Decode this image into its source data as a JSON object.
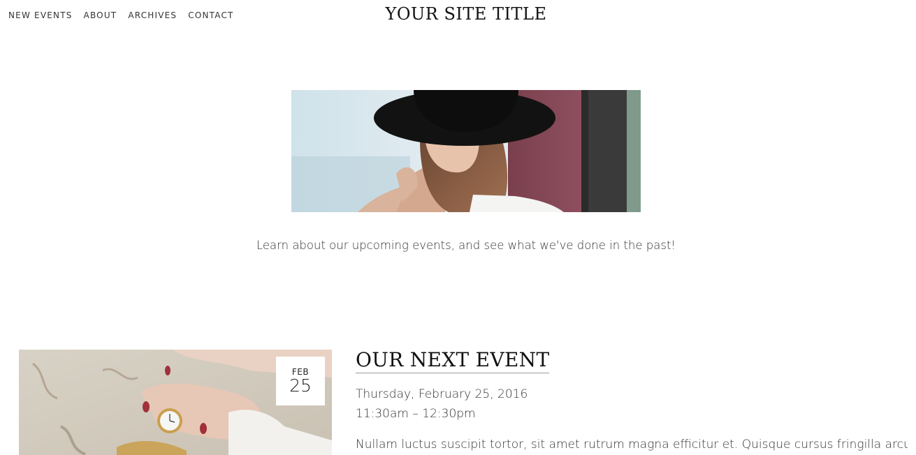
{
  "header": {
    "nav": [
      {
        "label": "NEW EVENTS"
      },
      {
        "label": "ABOUT"
      },
      {
        "label": "ARCHIVES"
      },
      {
        "label": "CONTACT"
      }
    ],
    "site_title": "YOUR SITE TITLE"
  },
  "intro": {
    "text": "Learn about our upcoming events, and see what we've done in the past!"
  },
  "event": {
    "badge_month": "FEB",
    "badge_day": "25",
    "heading": "OUR NEXT EVENT",
    "date": "Thursday, February 25, 2016",
    "time": "11:30am – 12:30pm",
    "excerpt": "Nullam luctus suscipit tortor, sit amet rutrum magna efficitur et. Quisque cursus fringilla arcu sed"
  }
}
